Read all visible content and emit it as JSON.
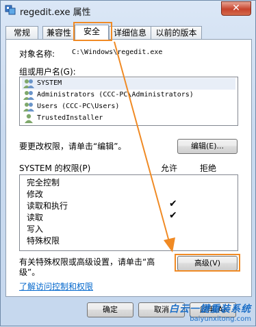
{
  "window": {
    "title": "regedit.exe 属性",
    "close_glyph": "✕"
  },
  "tabs": [
    {
      "label": "常规",
      "active": false
    },
    {
      "label": "兼容性",
      "active": false
    },
    {
      "label": "安全",
      "active": true
    },
    {
      "label": "详细信息",
      "active": false
    },
    {
      "label": "以前的版本",
      "active": false
    }
  ],
  "security": {
    "object_name_label": "对象名称:",
    "object_name_value": "C:\\Windows\\regedit.exe",
    "groups_label": "组或用户名(G):",
    "users": [
      {
        "name": "SYSTEM",
        "icon": "users-group-icon",
        "selected": true
      },
      {
        "name": "Administrators (CCC-PC\\Administrators)",
        "icon": "users-group-icon",
        "selected": false
      },
      {
        "name": "Users (CCC-PC\\Users)",
        "icon": "users-group-icon",
        "selected": false
      },
      {
        "name": "TrustedInstaller",
        "icon": "user-icon",
        "selected": false
      }
    ],
    "change_hint": "要更改权限，请单击“编辑”。",
    "edit_button": "编辑(E)...",
    "permissions_label": "SYSTEM 的权限(P)",
    "allow_header": "允许",
    "deny_header": "拒绝",
    "permissions": [
      {
        "name": "完全控制",
        "allow": false,
        "deny": false
      },
      {
        "name": "修改",
        "allow": false,
        "deny": false
      },
      {
        "name": "读取和执行",
        "allow": true,
        "deny": false
      },
      {
        "name": "读取",
        "allow": true,
        "deny": false
      },
      {
        "name": "写入",
        "allow": false,
        "deny": false
      },
      {
        "name": "特殊权限",
        "allow": false,
        "deny": false
      }
    ],
    "check_glyph": "✔",
    "advanced_hint_line1": "有关特殊权限或高级设置，请单击“高",
    "advanced_hint_line2": "级”。",
    "advanced_button": "高级(V)",
    "learn_link": "了解访问控制和权限"
  },
  "footer": {
    "ok_button": "确定",
    "cancel_button": "取消",
    "apply_button": "应用(A)"
  },
  "watermark": {
    "title": "白云一键重装系统",
    "url": "baiyunxitong.com"
  },
  "highlight_color": "#f08a24"
}
